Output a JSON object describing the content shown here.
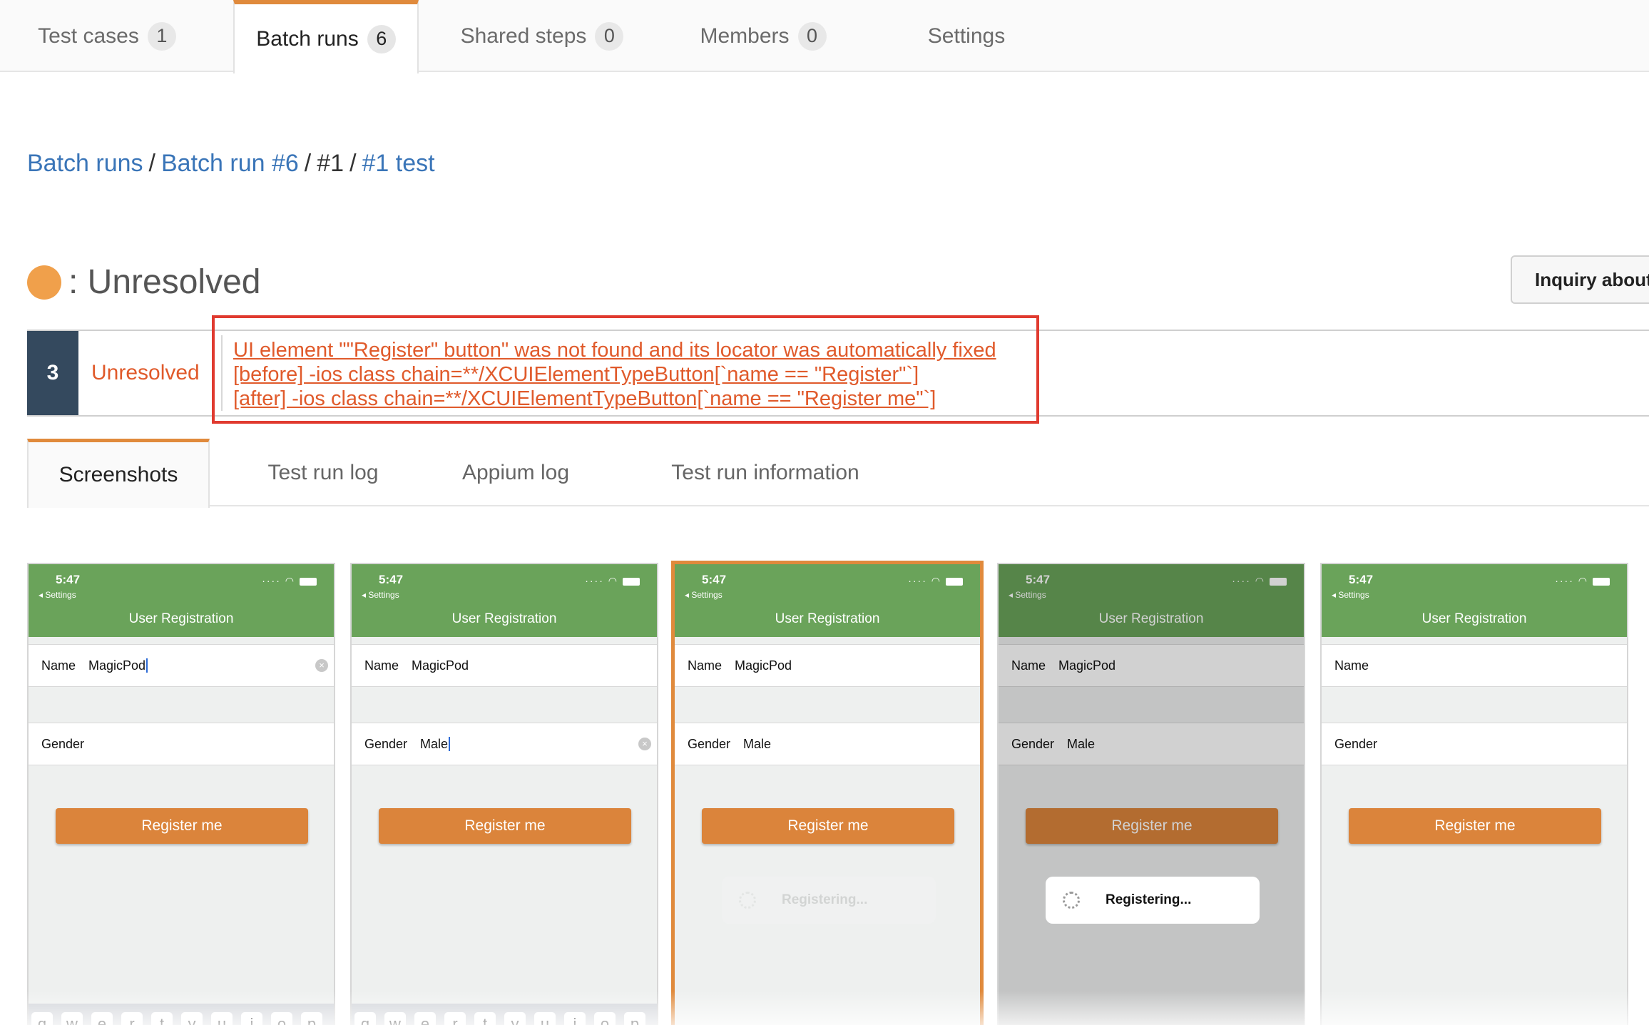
{
  "top_tabs": [
    {
      "label": "Test cases",
      "count": "1"
    },
    {
      "label": "Batch runs",
      "count": "6"
    },
    {
      "label": "Shared steps",
      "count": "0"
    },
    {
      "label": "Members",
      "count": "0"
    },
    {
      "label": "Settings"
    }
  ],
  "breadcrumb": {
    "batch_runs": "Batch runs",
    "batch_run": "Batch run #6",
    "run": "#1",
    "test": "#1 test",
    "sep": "/"
  },
  "status": {
    "label": ": Unresolved",
    "color": "#f0a04b"
  },
  "inquiry_button": "Inquiry about",
  "log": {
    "step_number": "3",
    "result": "Unresolved",
    "lines": [
      "UI element \"\"Register\" button\" was not found and its locator was automatically fixed",
      "[before] -ios class chain=**/XCUIElementTypeButton[`name == \"Register\"`]",
      "[after] -ios class chain=**/XCUIElementTypeButton[`name == \"Register me\"`]"
    ]
  },
  "sub_tabs": [
    "Screenshots",
    "Test run log",
    "Appium log",
    "Test run information"
  ],
  "phone": {
    "time": "5:47",
    "back": "◂ Settings",
    "title": "User Registration",
    "name_label": "Name",
    "gender_label": "Gender",
    "button": "Register me",
    "toast": "Registering..."
  },
  "screenshots": [
    {
      "name_value": "MagicPod",
      "gender_value": "",
      "keyboard": true
    },
    {
      "name_value": "MagicPod",
      "gender_value": "Male",
      "keyboard": true
    },
    {
      "name_value": "MagicPod",
      "gender_value": "Male",
      "selected": true
    },
    {
      "name_value": "MagicPod",
      "gender_value": "Male",
      "dimmed": true
    },
    {
      "name_value": "",
      "gender_value": ""
    }
  ],
  "keyboard_keys": [
    "q",
    "w",
    "e",
    "r",
    "t",
    "y",
    "u",
    "i",
    "o",
    "p"
  ],
  "colors": {
    "accent": "#e08a3c",
    "link": "#3a75b8",
    "error": "#e05a2b",
    "nav_green": "#6aa35a",
    "button_orange": "#db843b"
  }
}
